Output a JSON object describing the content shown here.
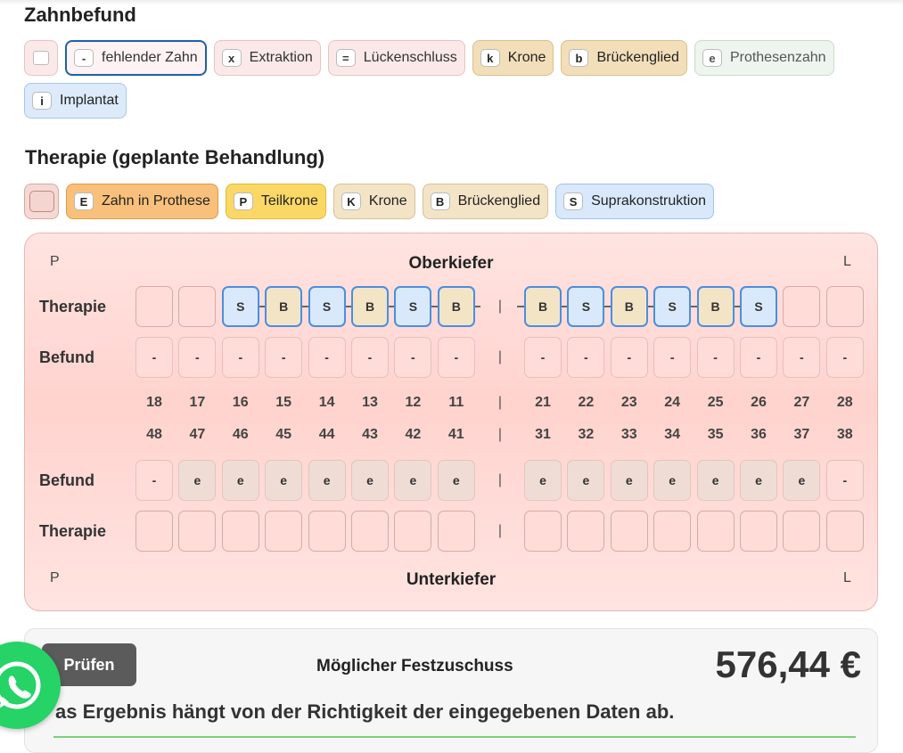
{
  "befund_section": {
    "title": "Zahnbefund",
    "chips": [
      {
        "key": "",
        "label": ""
      },
      {
        "key": "-",
        "label": "fehlender Zahn"
      },
      {
        "key": "x",
        "label": "Extraktion"
      },
      {
        "key": "=",
        "label": "Lückenschluss"
      },
      {
        "key": "k",
        "label": "Krone"
      },
      {
        "key": "b",
        "label": "Brückenglied"
      },
      {
        "key": "e",
        "label": "Prothesenzahn"
      },
      {
        "key": "i",
        "label": "Implantat"
      }
    ]
  },
  "therapie_section": {
    "title": "Therapie (geplante Behandlung)",
    "chips": [
      {
        "key": "",
        "label": ""
      },
      {
        "key": "E",
        "label": "Zahn in Prothese"
      },
      {
        "key": "P",
        "label": "Teilkrone"
      },
      {
        "key": "K",
        "label": "Krone"
      },
      {
        "key": "B",
        "label": "Brückenglied"
      },
      {
        "key": "S",
        "label": "Suprakonstruktion"
      }
    ]
  },
  "chart": {
    "upper_title": "Oberkiefer",
    "lower_title": "Unterkiefer",
    "left_side": "P",
    "right_side": "L",
    "separator": "|",
    "row_labels": {
      "therapie": "Therapie",
      "befund": "Befund"
    },
    "upper_numbers": [
      "18",
      "17",
      "16",
      "15",
      "14",
      "13",
      "12",
      "11",
      "21",
      "22",
      "23",
      "24",
      "25",
      "26",
      "27",
      "28"
    ],
    "lower_numbers": [
      "48",
      "47",
      "46",
      "45",
      "44",
      "43",
      "42",
      "41",
      "31",
      "32",
      "33",
      "34",
      "35",
      "36",
      "37",
      "38"
    ],
    "upper_therapie": [
      "",
      "",
      "S",
      "B",
      "S",
      "B",
      "S",
      "B",
      "B",
      "S",
      "B",
      "S",
      "B",
      "S",
      "",
      ""
    ],
    "upper_befund": [
      "-",
      "-",
      "-",
      "-",
      "-",
      "-",
      "-",
      "-",
      "-",
      "-",
      "-",
      "-",
      "-",
      "-",
      "-",
      "-"
    ],
    "lower_befund": [
      "-",
      "e",
      "e",
      "e",
      "e",
      "e",
      "e",
      "e",
      "e",
      "e",
      "e",
      "e",
      "e",
      "e",
      "e",
      "-"
    ],
    "lower_therapie": [
      "",
      "",
      "",
      "",
      "",
      "",
      "",
      "",
      "",
      "",
      "",
      "",
      "",
      "",
      "",
      ""
    ]
  },
  "result": {
    "button": "Prüfen",
    "label": "Möglicher Festzuschuss",
    "amount": "576,44 €",
    "note": "as Ergebnis hängt von der Richtigkeit der eingegebenen Daten ab."
  }
}
